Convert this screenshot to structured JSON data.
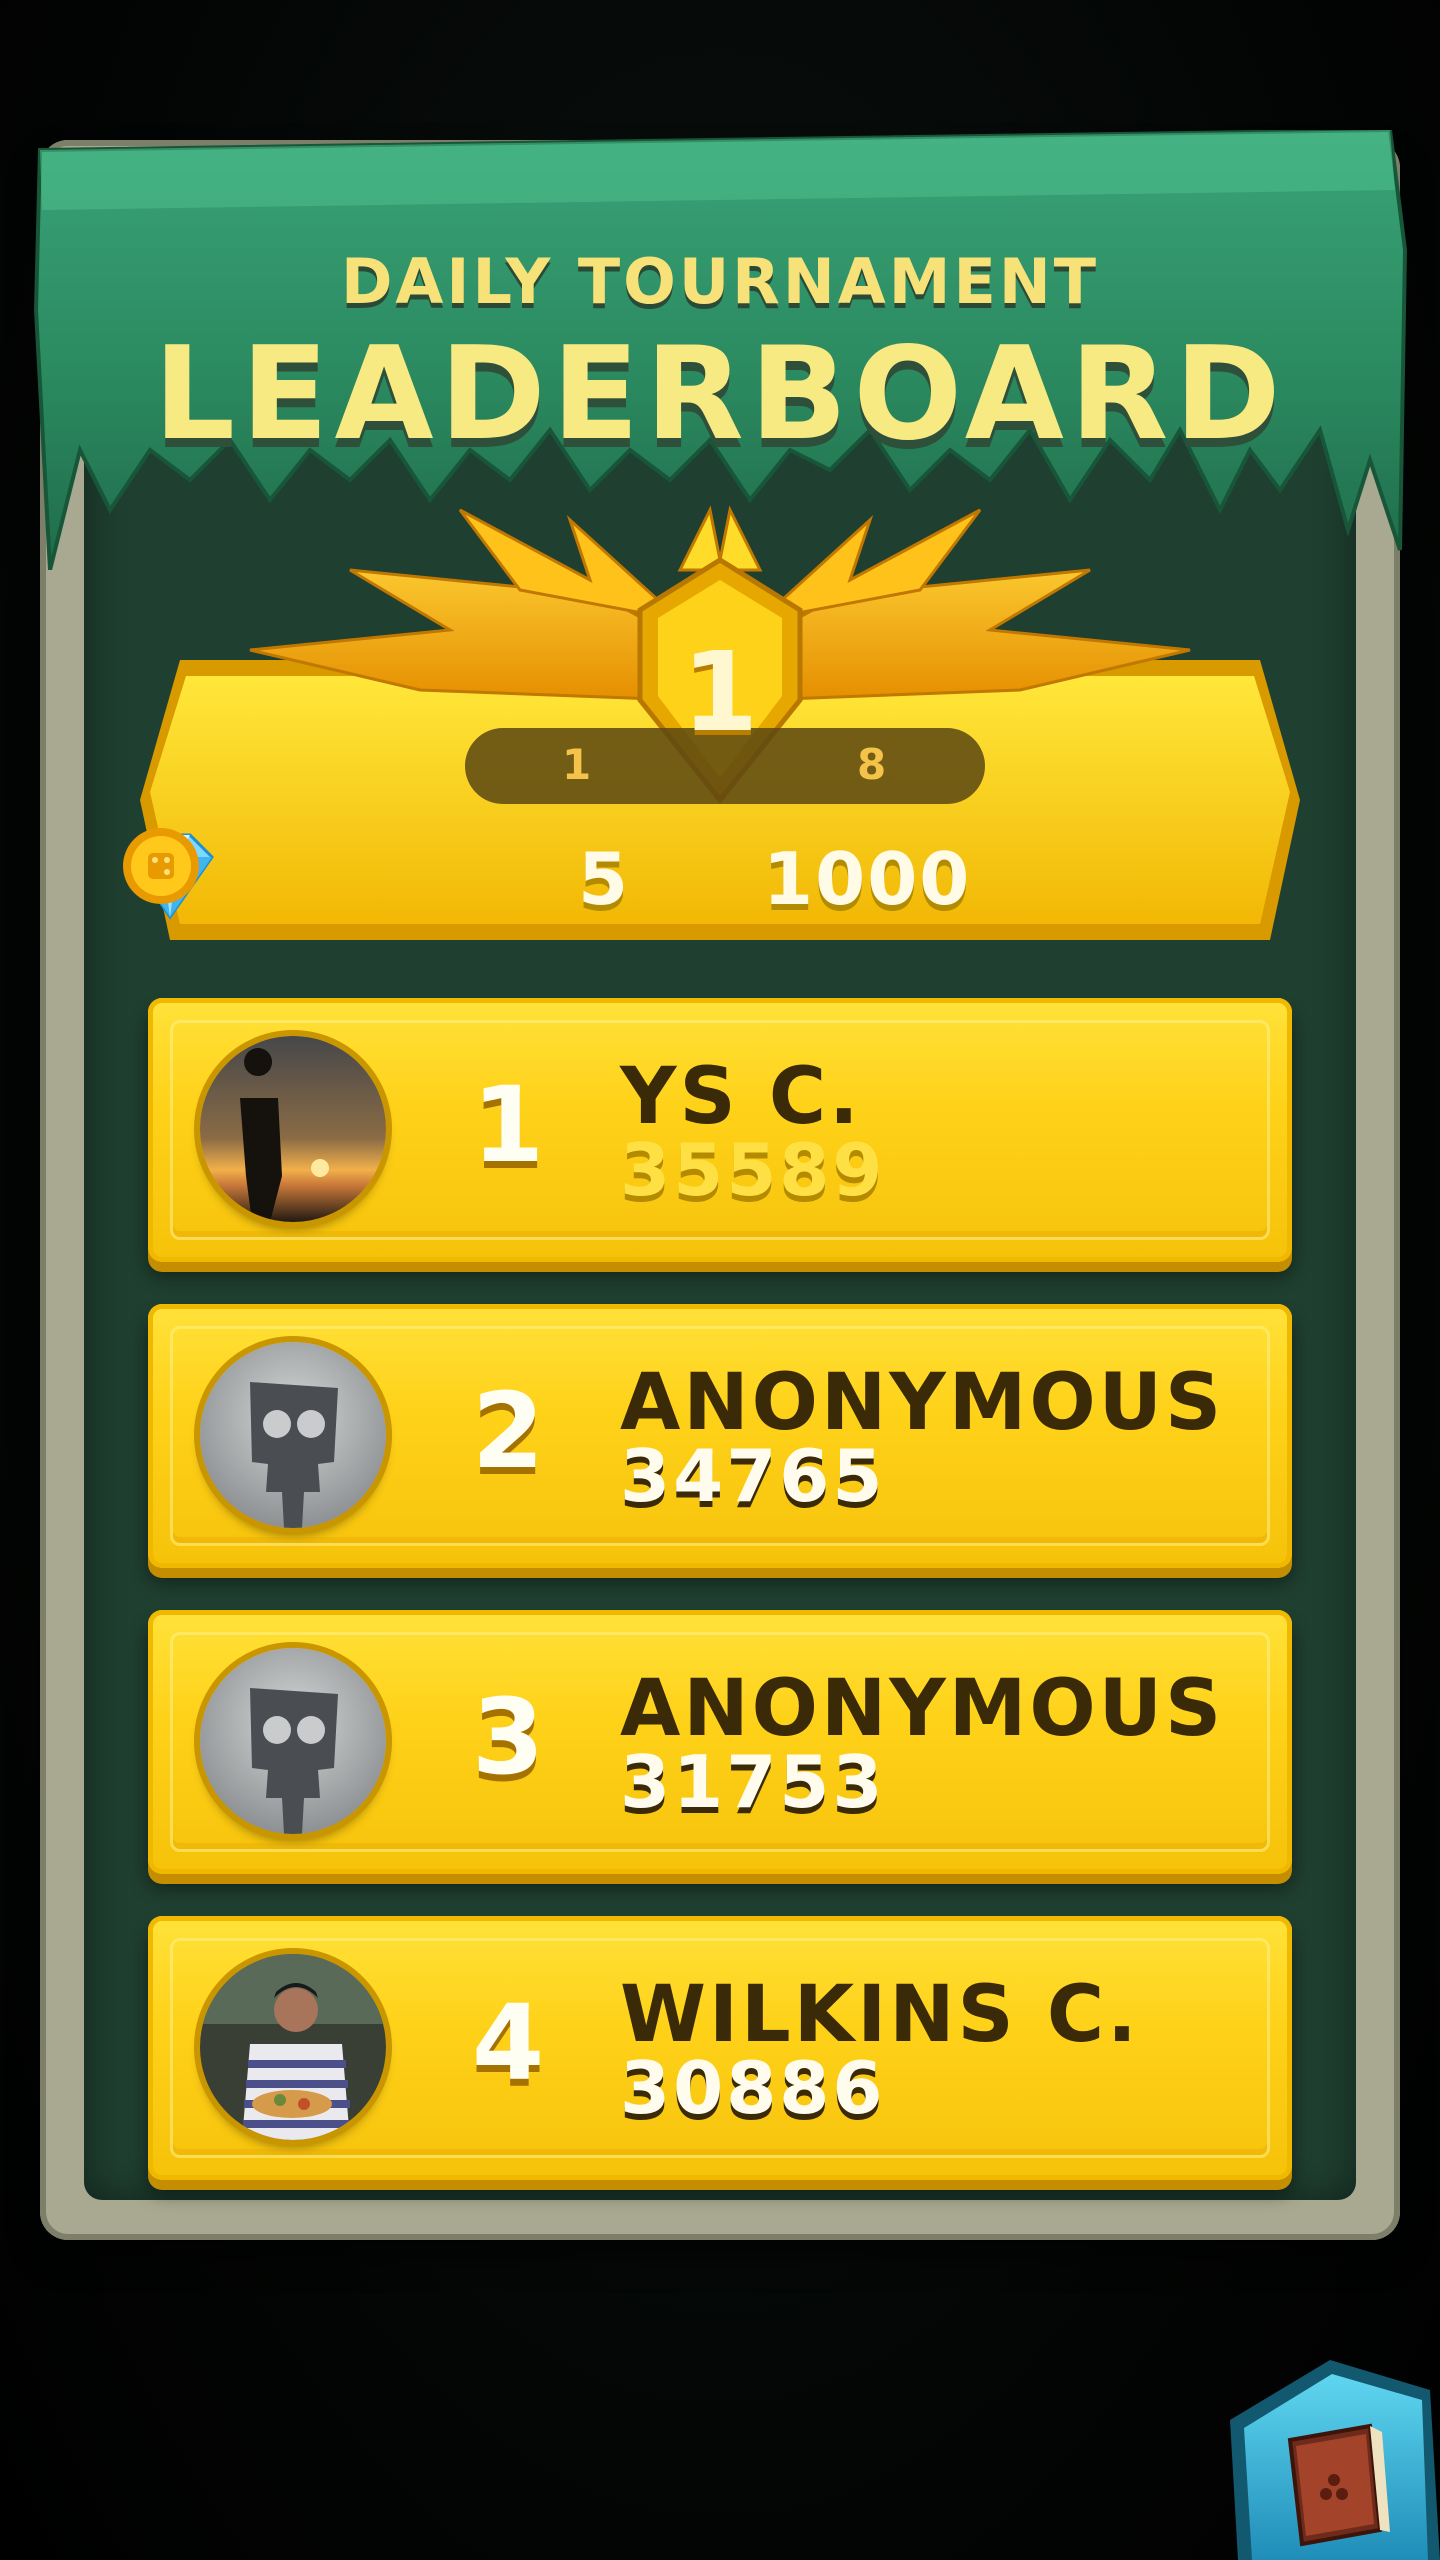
{
  "header": {
    "subtitle": "DAILY TOURNAMENT",
    "title": "LEADERBOARD"
  },
  "rank_panel": {
    "current_rank": "1",
    "range_start": "1",
    "range_end": "8",
    "reward_gems": "5",
    "reward_coins": "1000"
  },
  "players": [
    {
      "rank": "1",
      "name": "YS C.",
      "score": "35589",
      "avatar": "photo-sunset"
    },
    {
      "rank": "2",
      "name": "ANONYMOUS",
      "score": "34765",
      "avatar": "default-avatar"
    },
    {
      "rank": "3",
      "name": "ANONYMOUS",
      "score": "31753",
      "avatar": "default-avatar"
    },
    {
      "rank": "4",
      "name": "WILKINS C.",
      "score": "30886",
      "avatar": "photo-person"
    }
  ],
  "icons": {
    "gem": "diamond-icon",
    "coin": "coin-icon",
    "book": "book-icon"
  },
  "colors": {
    "banner_green": "#2f8a62",
    "board_green": "#1f3f30",
    "row_gold": "#ffd21a",
    "text_dark": "#3a2a07",
    "title_yellow": "#f8ea82"
  }
}
